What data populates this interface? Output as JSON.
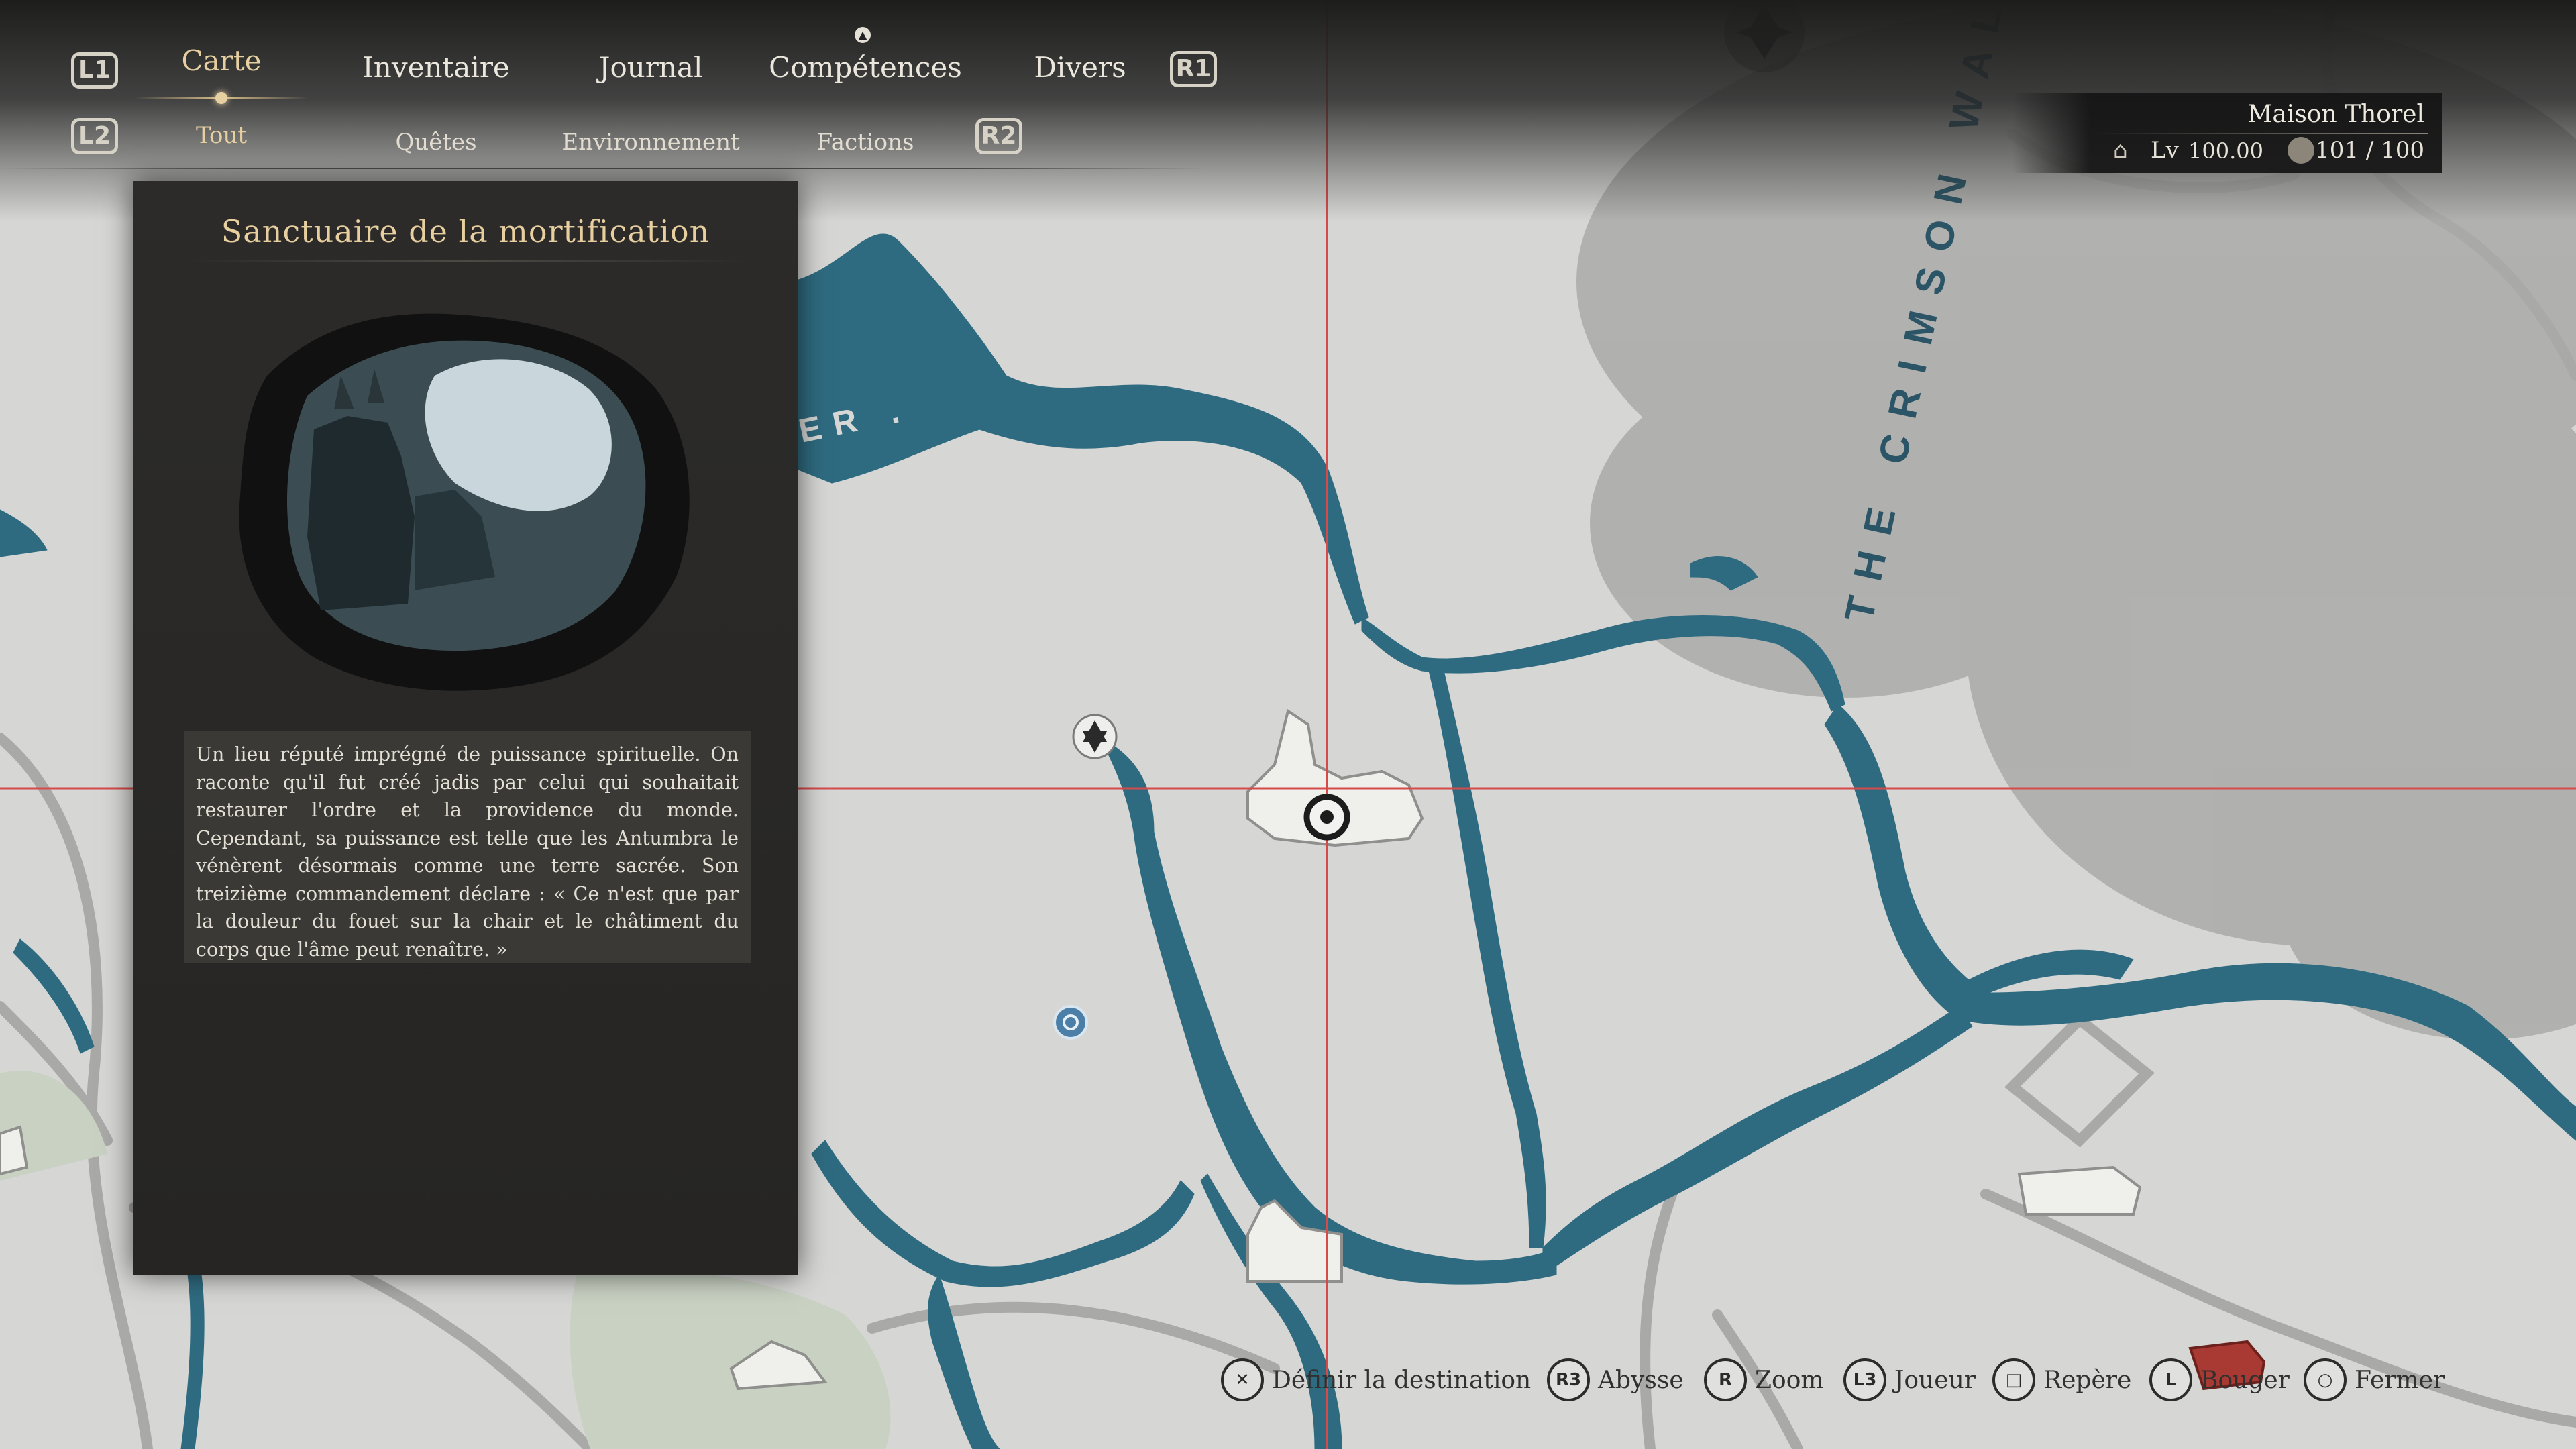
{
  "nav": {
    "left_bumper": "L1",
    "right_bumper": "R1",
    "left_trigger": "L2",
    "right_trigger": "R2",
    "tabs": [
      {
        "label": "Carte",
        "active": true
      },
      {
        "label": "Inventaire",
        "active": false
      },
      {
        "label": "Journal",
        "active": false
      },
      {
        "label": "Compétences",
        "active": false
      },
      {
        "label": "Divers",
        "active": false
      }
    ],
    "subtabs": [
      {
        "label": "Tout",
        "active": true
      },
      {
        "label": "Quêtes",
        "active": false
      },
      {
        "label": "Environnement",
        "active": false
      },
      {
        "label": "Factions",
        "active": false
      }
    ]
  },
  "location_panel": {
    "title": "Sanctuaire de la mortification",
    "description": "Un lieu réputé imprégné de puissance spirituelle. On raconte qu'il fut créé jadis par celui qui souhaitait restaurer l'ordre et la providence du monde. Cependant, sa puissance est telle que les Antumbra le vénèrent désormais comme une terre sacrée. Son treizième commandement déclare : « Ce n'est que par la douleur du fouet sur la chair et le châtiment du corps que l'âme peut renaître. »"
  },
  "status": {
    "name": "Maison Thorel",
    "level_label": "Lv",
    "level_value": "100.00",
    "count": "101 / 100"
  },
  "map": {
    "labels": {
      "region_wall": "THE CRIMSON WALL",
      "region_river_fragment": "ER ."
    },
    "colors": {
      "land": "#d6d6d4",
      "water": "#2f6b80",
      "fog": "#a8a8a6",
      "crosshair": "#d64a4a",
      "roads": "#a9a9a7"
    }
  },
  "controls": [
    {
      "button": "✕",
      "label": "Définir la destination"
    },
    {
      "button": "R3",
      "label": "Abysse"
    },
    {
      "button": "R",
      "label": "Zoom"
    },
    {
      "button": "L3",
      "label": "Joueur"
    },
    {
      "button": "□",
      "label": "Repère"
    },
    {
      "button": "L",
      "label": "Bouger"
    },
    {
      "button": "○",
      "label": "Fermer"
    }
  ],
  "icons": {
    "map_marker": "shrine-icon",
    "player": "player-marker-icon",
    "waypoint": "waypoint-icon",
    "top_emblem": "compass-emblem-icon",
    "level_icon": "level-emblem-icon",
    "count_icon": "shield-emblem-icon",
    "chest": "chest-icon"
  }
}
